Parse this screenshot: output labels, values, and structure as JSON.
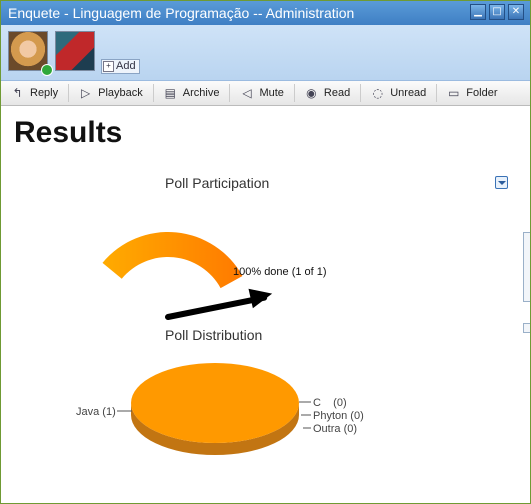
{
  "window": {
    "title": "Enquete - Linguagem de Programação -- Administration"
  },
  "window_controls": {
    "minimize": "▁",
    "maximize": "□",
    "close": "✕"
  },
  "participants": {
    "add_label": "Add"
  },
  "toolbar": {
    "items": [
      {
        "label": "Reply",
        "icon": "reply-icon"
      },
      {
        "label": "Playback",
        "icon": "play-icon"
      },
      {
        "label": "Archive",
        "icon": "archive-icon"
      },
      {
        "label": "Mute",
        "icon": "mute-icon"
      },
      {
        "label": "Read",
        "icon": "eye-icon"
      },
      {
        "label": "Unread",
        "icon": "eye-closed-icon"
      },
      {
        "label": "Folder",
        "icon": "folder-icon"
      }
    ]
  },
  "content": {
    "title": "Results",
    "participation": {
      "label": "Poll Participation",
      "gauge_text": "100% done (1 of 1)",
      "gauge_fraction": 1.0
    },
    "distribution": {
      "label": "Poll Distribution"
    }
  },
  "chart_data": {
    "type": "pie",
    "categories": [
      "Java",
      "C",
      "Phyton",
      "Outra"
    ],
    "values": [
      1,
      0,
      0,
      0
    ],
    "labels": [
      "Java (1)",
      "C    (0)",
      "Phyton (0)",
      "Outra (0)"
    ],
    "colors": {
      "slice": "#ff9900",
      "side": "#c27512"
    }
  }
}
